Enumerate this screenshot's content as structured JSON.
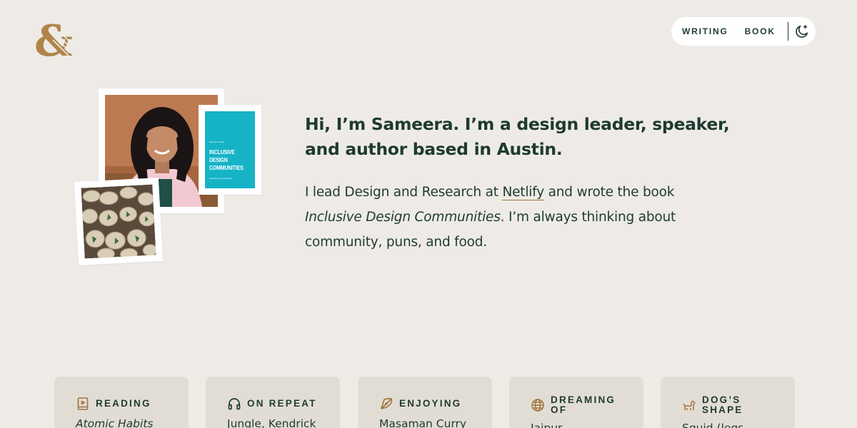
{
  "header": {
    "logo_icon": "ampersand-logo-icon",
    "nav": [
      {
        "label": "WRITING"
      },
      {
        "label": "BOOK"
      }
    ],
    "theme_toggle_icon": "moon-star-icon"
  },
  "hero": {
    "book_cover": {
      "author": "Sameera Kapila",
      "title": "INCLUSIVE DESIGN COMMUNITIES",
      "subtitle": "Breaking Down Barriers"
    },
    "headline": "Hi, I’m Sameera. I’m a design leader, speaker, and author based in Austin.",
    "intro": {
      "part1": "I lead Design and Research at ",
      "link": "Netlify",
      "part2": " and wrote the book ",
      "book": "Inclusive Design Communities",
      "part3": ". I’m always thinking about community, puns, and food."
    }
  },
  "cards": [
    {
      "label": "READING",
      "icon": "book-icon",
      "value": "Atomic Habits"
    },
    {
      "label": "ON REPEAT",
      "icon": "headphones-icon",
      "value": "Jungle, Kendrick"
    },
    {
      "label": "ENJOYING",
      "icon": "pizza-slice-icon",
      "value": "Masaman Curry"
    },
    {
      "label": "DREAMING OF",
      "icon": "globe-icon",
      "value": "Jaipur"
    },
    {
      "label": "DOG’S SHAPE",
      "icon": "dog-icon",
      "value": "Squid (legs"
    }
  ],
  "colors": {
    "background": "#eeebe6",
    "text": "#1e3a31",
    "accent": "#b0844a",
    "card": "#e2ddd4",
    "book_cover": "#16b3c7"
  }
}
